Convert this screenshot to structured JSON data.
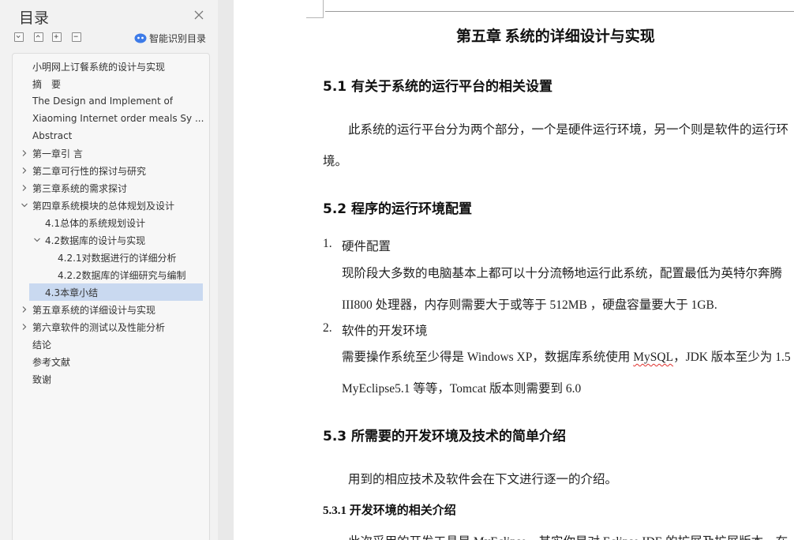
{
  "sidebar": {
    "title": "目录",
    "ai_toc_label": "智能识别目录",
    "icons": {
      "close": "close-icon",
      "collapse_all": "collapse-all-icon",
      "expand_all": "expand-all-icon",
      "add": "plus-icon",
      "remove": "minus-icon",
      "ai": "ai-robot-icon"
    },
    "toc": [
      {
        "label": "小明网上订餐系统的设计与实现",
        "level": 0,
        "chevron": "none"
      },
      {
        "label": "摘　要",
        "level": 0,
        "chevron": "none"
      },
      {
        "label": "The Design and Implement of",
        "level": 0,
        "chevron": "none"
      },
      {
        "label": "Xiaoming Internet order meals Sy ...",
        "level": 0,
        "chevron": "none"
      },
      {
        "label": "Abstract",
        "level": 0,
        "chevron": "none"
      },
      {
        "label": "第一章引 言",
        "level": 0,
        "chevron": "right"
      },
      {
        "label": "第二章可行性的探讨与研究",
        "level": 0,
        "chevron": "right"
      },
      {
        "label": "第三章系统的需求探讨",
        "level": 0,
        "chevron": "right"
      },
      {
        "label": "第四章系统模块的总体规划及设计",
        "level": 0,
        "chevron": "down"
      },
      {
        "label": "4.1总体的系统规划设计",
        "level": 1,
        "chevron": "none"
      },
      {
        "label": "4.2数据库的设计与实现",
        "level": 1,
        "chevron": "down"
      },
      {
        "label": "4.2.1对数据进行的详细分析",
        "level": 2,
        "chevron": "none"
      },
      {
        "label": "4.2.2数据库的详细研究与编制",
        "level": 2,
        "chevron": "none"
      },
      {
        "label": "4.3本章小结",
        "level": 1,
        "chevron": "none",
        "selected": true
      },
      {
        "label": "第五章系统的详细设计与实现",
        "level": 0,
        "chevron": "right"
      },
      {
        "label": "第六章软件的测试以及性能分析",
        "level": 0,
        "chevron": "right"
      },
      {
        "label": "结论",
        "level": 0,
        "chevron": "none"
      },
      {
        "label": "参考文献",
        "level": 0,
        "chevron": "none"
      },
      {
        "label": "致谢",
        "level": 0,
        "chevron": "none"
      }
    ]
  },
  "document": {
    "chapter_title": "第五章  系统的详细设计与实现",
    "s51_title": "5.1  有关于系统的运行平台的相关设置",
    "s51_para_line1": "此系统的运行平台分为两个部分，一个是硬件运行环境，另一个则是软件的运行环",
    "s51_para_line2": "境。",
    "s52_title": "5.2  程序的运行环境配置",
    "item1_num": "1.",
    "item1_title": "硬件配置",
    "item1_line1": "现阶段大多数的电脑基本上都可以十分流畅地运行此系统，配置最低为英特尔奔腾",
    "item1_line2": "III800 处理器，内存则需要大于或等于 512MB ，硬盘容量要大于 1GB.",
    "item2_num": "2.",
    "item2_title": "软件的开发环境",
    "item2_line1_a": "需要操作系统至少得是 Windows XP，数据库系统使用 ",
    "item2_line1_b": "MySQL",
    "item2_line1_c": "，JDK 版本至少为 1.5",
    "item2_line2": "MyEclipse5.1 等等，Tomcat 版本则需要到 6.0",
    "s53_title": "5.3  所需要的开发环境及技术的简单介绍",
    "s53_para": "用到的相应技术及软件会在下文进行逐一的介绍。",
    "s531_title": "5.3.1  开发环境的相关介绍",
    "s531_para_partial": "此次采用的开发工具是 MyEclipse，其实你是对 Eclipse IDE 的扩展及扩展版本，在"
  }
}
